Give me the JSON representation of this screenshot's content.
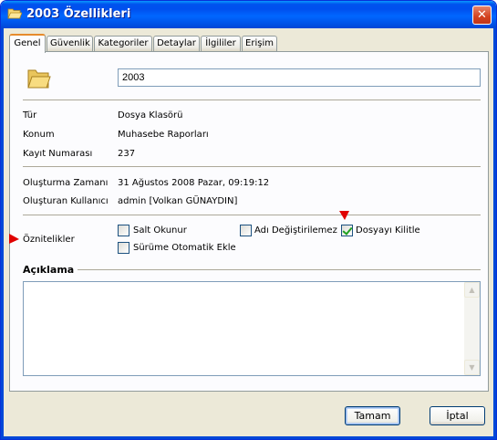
{
  "window": {
    "title": "2003 Özellikleri",
    "close_label": "✕"
  },
  "tabs": [
    {
      "label": "Genel",
      "active": true
    },
    {
      "label": "Güvenlik"
    },
    {
      "label": "Kategoriler"
    },
    {
      "label": "Detaylar"
    },
    {
      "label": "İlgililer"
    },
    {
      "label": "Erişim"
    }
  ],
  "general": {
    "name_value": "2003",
    "fields": [
      {
        "label": "Tür",
        "value": "Dosya Klasörü"
      },
      {
        "label": "Konum",
        "value": "Muhasebe Raporları"
      },
      {
        "label": "Kayıt Numarası",
        "value": "237"
      },
      {
        "label": "Oluşturma Zamanı",
        "value": "31 Ağustos 2008 Pazar, 09:19:12"
      },
      {
        "label": "Oluşturan Kullanıcı",
        "value": "admin [Volkan GÜNAYDIN]"
      }
    ],
    "attributes_label": "Öznitelikler",
    "attributes": [
      {
        "label": "Salt Okunur",
        "checked": false
      },
      {
        "label": "Adı Değiştirilemez",
        "checked": false
      },
      {
        "label": "Dosyayı Kilitle",
        "checked": true
      },
      {
        "label": "Sürüme Otomatik Ekle",
        "checked": false
      }
    ],
    "description_label": "Açıklama",
    "description_value": ""
  },
  "buttons": {
    "ok": "Tamam",
    "cancel": "İptal"
  },
  "colors": {
    "titlebar": "#0054e3",
    "dialog_bg": "#ece9d8",
    "active_tab_accent": "#e68b2c",
    "annotation_arrow": "#e00000",
    "checkmark": "#21a121"
  }
}
